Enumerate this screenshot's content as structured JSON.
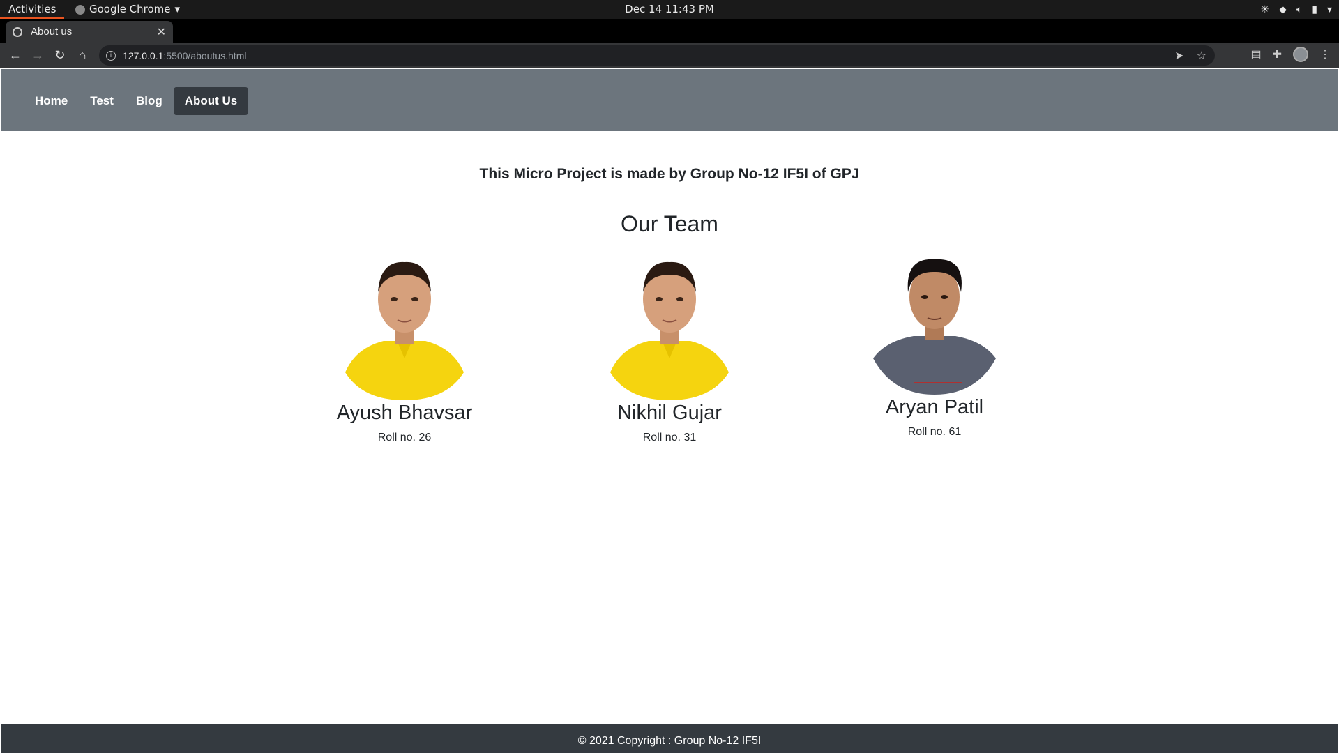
{
  "os": {
    "activities": "Activities",
    "app_name": "Google Chrome",
    "clock": "Dec 14  11:43 PM"
  },
  "browser": {
    "tab_title": "About us",
    "url_host": "127.0.0.1",
    "url_rest": ":5500/aboutus.html"
  },
  "nav": {
    "items": [
      {
        "label": "Home",
        "active": false
      },
      {
        "label": "Test",
        "active": false
      },
      {
        "label": "Blog",
        "active": false
      },
      {
        "label": "About Us",
        "active": true
      }
    ]
  },
  "content": {
    "headline": "This Micro Project is made by Group No-12 IF5I of GPJ",
    "team_title": "Our Team",
    "members": [
      {
        "name": "Ayush Bhavsar",
        "roll": "Roll no. 26",
        "shirt_color": "#f5d40f"
      },
      {
        "name": "Nikhil Gujar",
        "roll": "Roll no. 31",
        "shirt_color": "#f5d40f"
      },
      {
        "name": "Aryan Patil",
        "roll": "Roll no. 61",
        "shirt_color": "#5a6070"
      }
    ]
  },
  "footer": {
    "text": "© 2021 Copyright : Group No-12 IF5I"
  },
  "colors": {
    "nav_bg": "#6c757d",
    "nav_active_bg": "#343a40",
    "footer_bg": "#343a40"
  }
}
